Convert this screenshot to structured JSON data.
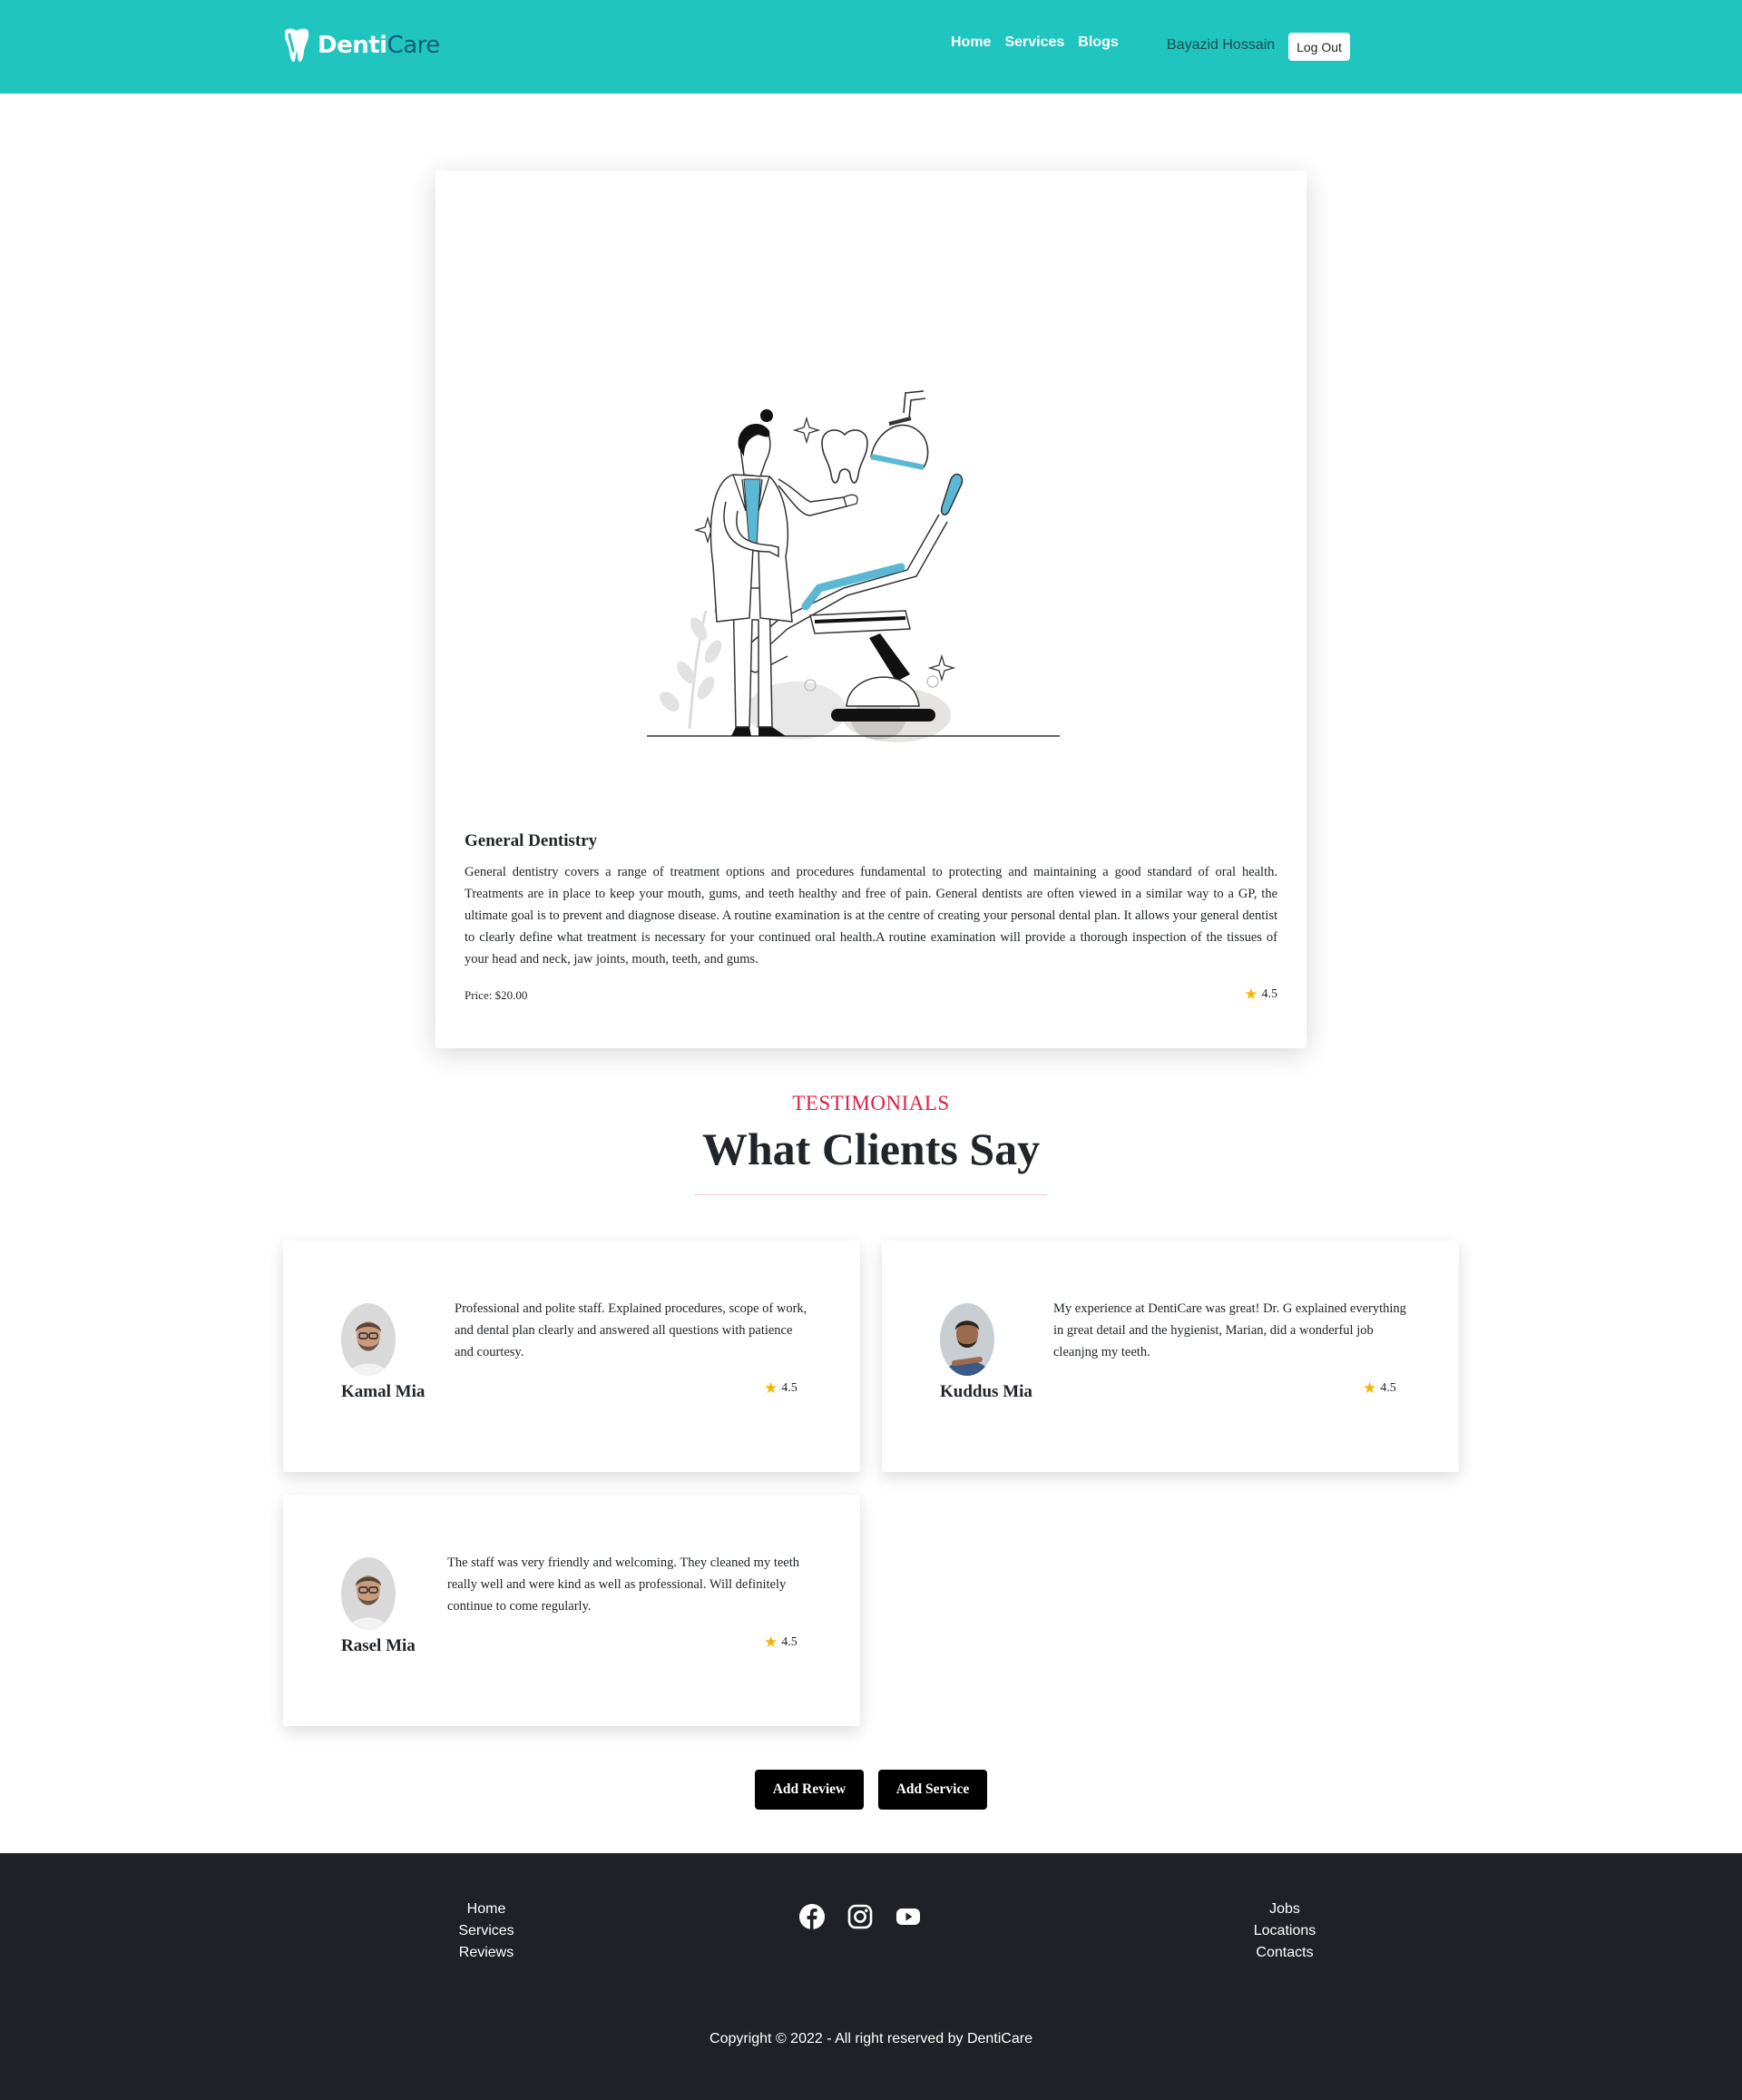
{
  "brand": {
    "name_bold": "Denti",
    "name_light": "Care"
  },
  "nav": {
    "links": [
      "Home",
      "Services",
      "Blogs"
    ],
    "user_name": "Bayazid Hossain",
    "logout_label": "Log Out"
  },
  "service": {
    "title": "General Dentistry",
    "description": "General dentistry covers a range of treatment options and procedures fundamental to protecting and maintaining a good standard of oral health. Treatments are in place to keep your mouth, gums, and teeth healthy and free of pain. General dentists are often viewed in a similar way to a GP, the ultimate goal is to prevent and diagnose disease. A routine examination is at the centre of creating your personal dental plan. It allows your general dentist to clearly define what treatment is necessary for your continued oral health.A routine examination will provide a thorough inspection of the tissues of your head and neck, jaw joints, mouth, teeth, and gums.",
    "price": "Price: $20.00",
    "rating": "4.5"
  },
  "testimonials": {
    "tag": "TESTIMONIALS",
    "heading": "What Clients Say",
    "reviews": [
      {
        "name": "Kamal Mia",
        "text": "Professional and polite staff. Explained procedures, scope of work, and dental plan clearly and answered all questions with patience and courtesy.",
        "rating": "4.5"
      },
      {
        "name": "Kuddus Mia",
        "text": "My experience at DentiCare was great! Dr. G explained everything in great detail and the hygienist, Marian, did a wonderful job cleanjng my teeth.",
        "rating": "4.5"
      },
      {
        "name": "Rasel Mia",
        "text": "The staff was very friendly and welcoming. They cleaned my teeth really well and were kind as well as professional. Will definitely continue to come regularly.",
        "rating": "4.5"
      }
    ]
  },
  "actions": {
    "add_review": "Add Review",
    "add_service": "Add Service"
  },
  "footer": {
    "left_links": [
      "Home",
      "Services",
      "Reviews"
    ],
    "right_links": [
      "Jobs",
      "Locations",
      "Contacts"
    ],
    "social_icons": [
      "facebook-icon",
      "instagram-icon",
      "youtube-icon"
    ],
    "copyright": "Copyright © 2022 - All right reserved by DentiCare"
  },
  "colors": {
    "primary": "#20c5c0",
    "accent": "#dc1f45",
    "star": "#f4b400",
    "footer_bg": "#202126",
    "chair_accent": "#5bb8d4"
  }
}
